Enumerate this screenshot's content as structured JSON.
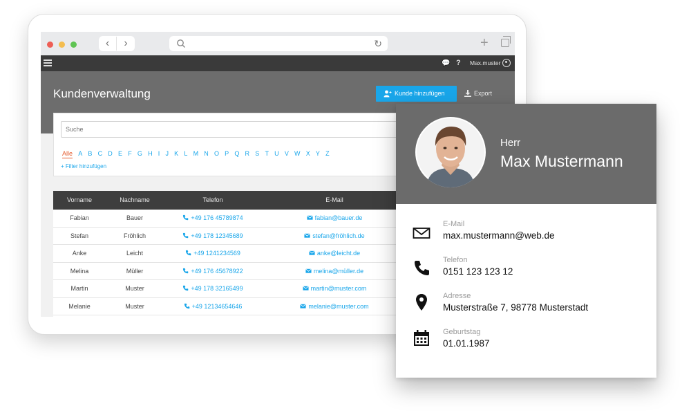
{
  "browser": {
    "back_glyph": "‹",
    "forward_glyph": "›",
    "reload_glyph": "↻",
    "new_tab_glyph": "+"
  },
  "appbar": {
    "help_glyph": "?",
    "chat_glyph": "💬",
    "username": "Max.muster"
  },
  "page": {
    "title": "Kundenverwaltung",
    "add_button_label": "Kunde hinzufügen",
    "export_label": "Export"
  },
  "filter": {
    "search_placeholder": "Suche",
    "letters": [
      "Alle",
      "A",
      "B",
      "C",
      "D",
      "E",
      "F",
      "G",
      "H",
      "I",
      "J",
      "K",
      "L",
      "M",
      "N",
      "O",
      "P",
      "Q",
      "R",
      "S",
      "T",
      "U",
      "V",
      "W",
      "X",
      "Y",
      "Z"
    ],
    "active_letter": "Alle",
    "add_filter_label": "+ Filter hinzufügen"
  },
  "table": {
    "headers": [
      "Vorname",
      "Nachname",
      "Telefon",
      "E-Mail"
    ],
    "rows": [
      {
        "vorname": "Fabian",
        "nachname": "Bauer",
        "telefon": "+49 176 45789874",
        "email": "fabian@bauer.de"
      },
      {
        "vorname": "Stefan",
        "nachname": "Fröhlich",
        "telefon": "+49 178 12345689",
        "email": "stefan@fröhlich.de"
      },
      {
        "vorname": "Anke",
        "nachname": "Leicht",
        "telefon": "+49 1241234569",
        "email": "anke@leicht.de"
      },
      {
        "vorname": "Melina",
        "nachname": "Müller",
        "telefon": "+49 176 45678922",
        "email": "melina@müller.de"
      },
      {
        "vorname": "Martin",
        "nachname": "Muster",
        "telefon": "+49 178 32165499",
        "email": "martin@muster.com"
      },
      {
        "vorname": "Melanie",
        "nachname": "Muster",
        "telefon": "+49 12134654646",
        "email": "melanie@muster.com"
      }
    ]
  },
  "contact": {
    "salutation": "Herr",
    "name": "Max Mustermann",
    "fields": [
      {
        "label": "E-Mail",
        "value": "max.mustermann@web.de",
        "icon": "envelope-icon"
      },
      {
        "label": "Telefon",
        "value": "0151 123 123 12",
        "icon": "phone-icon"
      },
      {
        "label": "Adresse",
        "value": "Musterstraße 7, 98778 Musterstadt",
        "icon": "location-pin-icon"
      },
      {
        "label": "Geburtstag",
        "value": "01.01.1987",
        "icon": "calendar-icon"
      }
    ]
  },
  "colors": {
    "accent": "#19a6ea",
    "active_letter": "#e45b2d",
    "header_gray": "#6d6d6d",
    "appbar_dark": "#3a3a3a",
    "table_header": "#3e3e3e"
  }
}
